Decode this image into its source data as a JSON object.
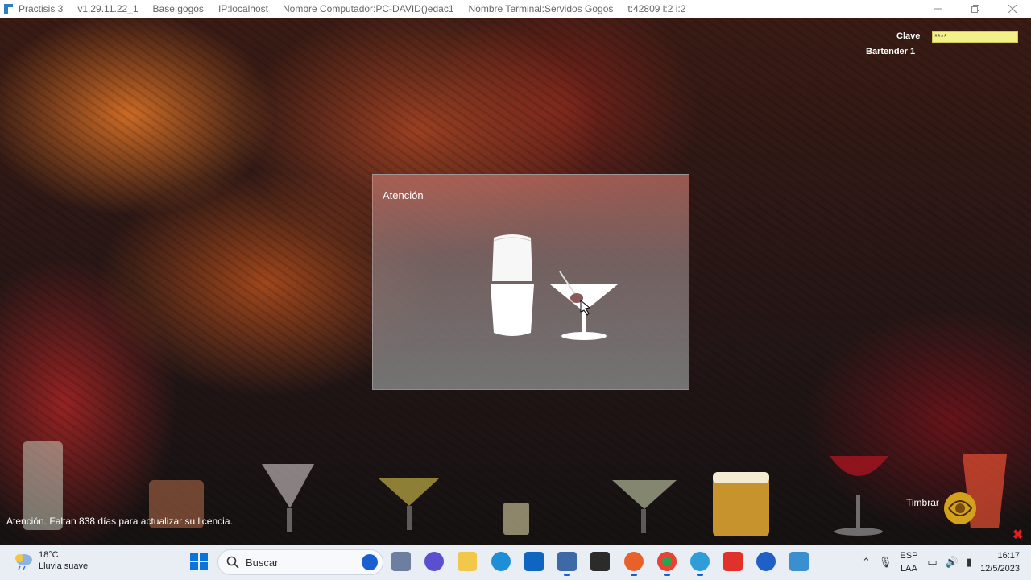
{
  "titlebar": {
    "app_name": "Practisis 3",
    "version": "v1.29.11.22_1",
    "base": "Base:gogos",
    "ip": "IP:localhost",
    "computer": "Nombre Computador:PC-DAVID()edac1",
    "terminal": "Nombre Terminal:Servidos Gogos",
    "terminal_id": "t:42809 l:2 i:2"
  },
  "login": {
    "clave_label": "Clave",
    "clave_value": "****",
    "user": "Bartender 1"
  },
  "dialog": {
    "title": "Atención"
  },
  "notice": "Atención. Faltan 838 días para actualizar su licencia.",
  "timbrar": "Timbrar",
  "taskbar": {
    "weather_temp": "18°C",
    "weather_desc": "Lluvia suave",
    "search_placeholder": "Buscar",
    "lang_1": "ESP",
    "lang_2": "LAA",
    "time": "16:17",
    "date": "12/5/2023"
  },
  "colors": {
    "clave_bg": "#f3f08a",
    "close_x": "#e02020",
    "accent": "#1a5fd0"
  }
}
